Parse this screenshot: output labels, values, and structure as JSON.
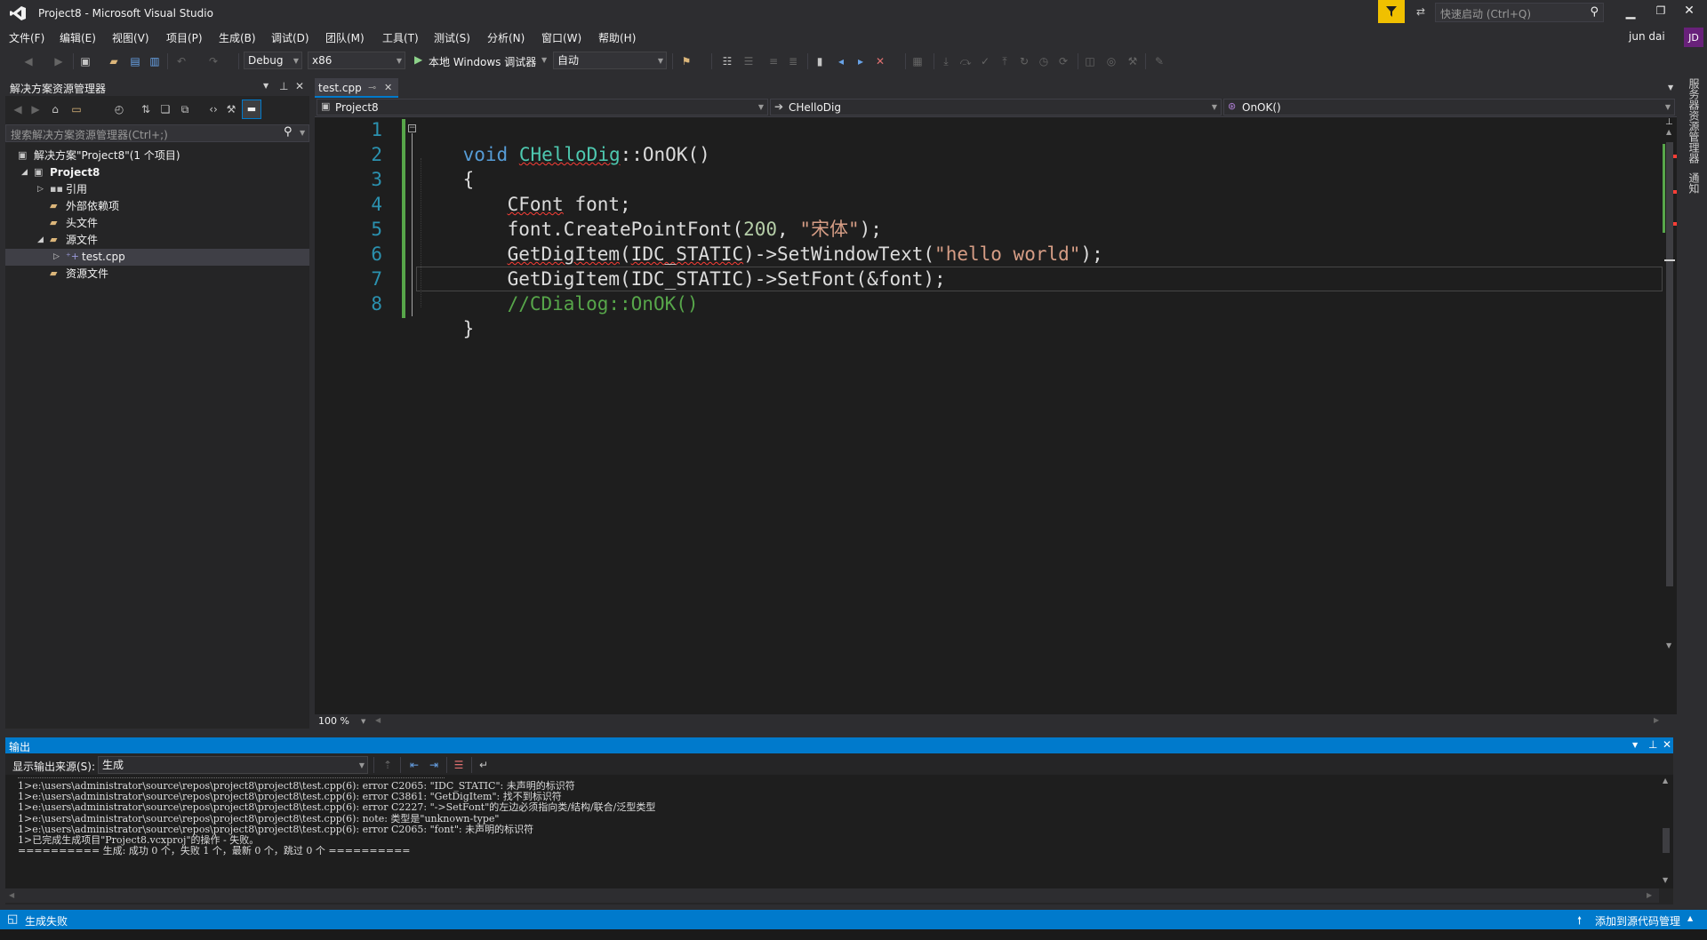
{
  "window": {
    "title": "Project8 - Microsoft Visual Studio",
    "quick_launch_placeholder": "快速启动 (Ctrl+Q)",
    "user_name": "jun dai",
    "user_initials": "JD"
  },
  "menu": [
    "文件(F)",
    "编辑(E)",
    "视图(V)",
    "项目(P)",
    "生成(B)",
    "调试(D)",
    "团队(M)",
    "工具(T)",
    "测试(S)",
    "分析(N)",
    "窗口(W)",
    "帮助(H)"
  ],
  "toolbar": {
    "config": "Debug",
    "platform": "x86",
    "run_label": "本地 Windows 调试器",
    "run_mode": "自动"
  },
  "solution_explorer": {
    "title": "解决方案资源管理器",
    "search_placeholder": "搜索解决方案资源管理器(Ctrl+;)",
    "items": [
      {
        "label": "解决方案\"Project8\"(1 个项目)",
        "depth": 0,
        "expander": "",
        "icon": "solution-icon"
      },
      {
        "label": "Project8",
        "depth": 1,
        "expander": "expanded",
        "icon": "project-icon"
      },
      {
        "label": "引用",
        "depth": 2,
        "expander": "collapsed",
        "icon": "references-icon"
      },
      {
        "label": "外部依赖项",
        "depth": 2,
        "expander": "",
        "icon": "folder-icon"
      },
      {
        "label": "头文件",
        "depth": 2,
        "expander": "",
        "icon": "folder-icon"
      },
      {
        "label": "源文件",
        "depth": 2,
        "expander": "expanded",
        "icon": "folder-icon"
      },
      {
        "label": "test.cpp",
        "depth": 3,
        "expander": "collapsed",
        "icon": "cpp-file-icon",
        "selected": true
      },
      {
        "label": "资源文件",
        "depth": 2,
        "expander": "",
        "icon": "folder-icon"
      }
    ]
  },
  "editor": {
    "tab_label": "test.cpp",
    "nav_project": "Project8",
    "nav_class": "CHelloDig",
    "nav_member": "OnOK()",
    "zoom": "100 %",
    "line_numbers": [
      "1",
      "2",
      "3",
      "4",
      "5",
      "6",
      "7",
      "8"
    ],
    "code": {
      "l1": [
        "void",
        "CHelloDig",
        "::OnOK()"
      ],
      "l2": "{",
      "l3": [
        "CFont",
        " font;"
      ],
      "l4": [
        "font.CreatePointFont(",
        "200",
        ", ",
        "\"宋体\"",
        ");"
      ],
      "l5": [
        "GetDigItem",
        "(",
        "IDC_STATIC",
        ")->SetWindowText(",
        "\"hello world\"",
        ");"
      ],
      "l6": [
        "GetDigItem",
        "(",
        "IDC_STATIC",
        ")->SetFont(&font);"
      ],
      "l7": "//CDialog::OnOK()",
      "l8": "}"
    }
  },
  "output": {
    "title": "输出",
    "source_label": "显示输出来源(S):",
    "source_value": "生成",
    "lines": [
      "1>e:\\users\\administrator\\source\\repos\\project8\\project8\\test.cpp(6): error C2065: \"IDC_STATIC\": 未声明的标识符",
      "1>e:\\users\\administrator\\source\\repos\\project8\\project8\\test.cpp(6): error C3861: \"GetDigItem\": 找不到标识符",
      "1>e:\\users\\administrator\\source\\repos\\project8\\project8\\test.cpp(6): error C2227: \"->SetFont\"的左边必须指向类/结构/联合/泛型类型",
      "1>e:\\users\\administrator\\source\\repos\\project8\\project8\\test.cpp(6): note: 类型是\"unknown-type\"",
      "1>e:\\users\\administrator\\source\\repos\\project8\\project8\\test.cpp(6): error C2065: \"font\": 未声明的标识符",
      "1>已完成生成项目\"Project8.vcxproj\"的操作 - 失败。",
      "========== 生成: 成功 0 个，失败 1 个，最新 0 个，跳过 0 个 =========="
    ]
  },
  "right_tabs": [
    "服务器资源管理器",
    "通知"
  ],
  "status": {
    "left": "生成失败",
    "right": "添加到源代码管理"
  },
  "colors": {
    "accent": "#007acc",
    "background": "#2d2d30",
    "editor_bg": "#1e1e1e",
    "panel_bg": "#252526",
    "keyword": "#569cd6",
    "type": "#4ec9b0",
    "string": "#d69d85",
    "comment": "#57a64a",
    "line_number": "#2b91af",
    "user_badge": "#68217a",
    "filter_icon_bg": "#f0c000"
  }
}
